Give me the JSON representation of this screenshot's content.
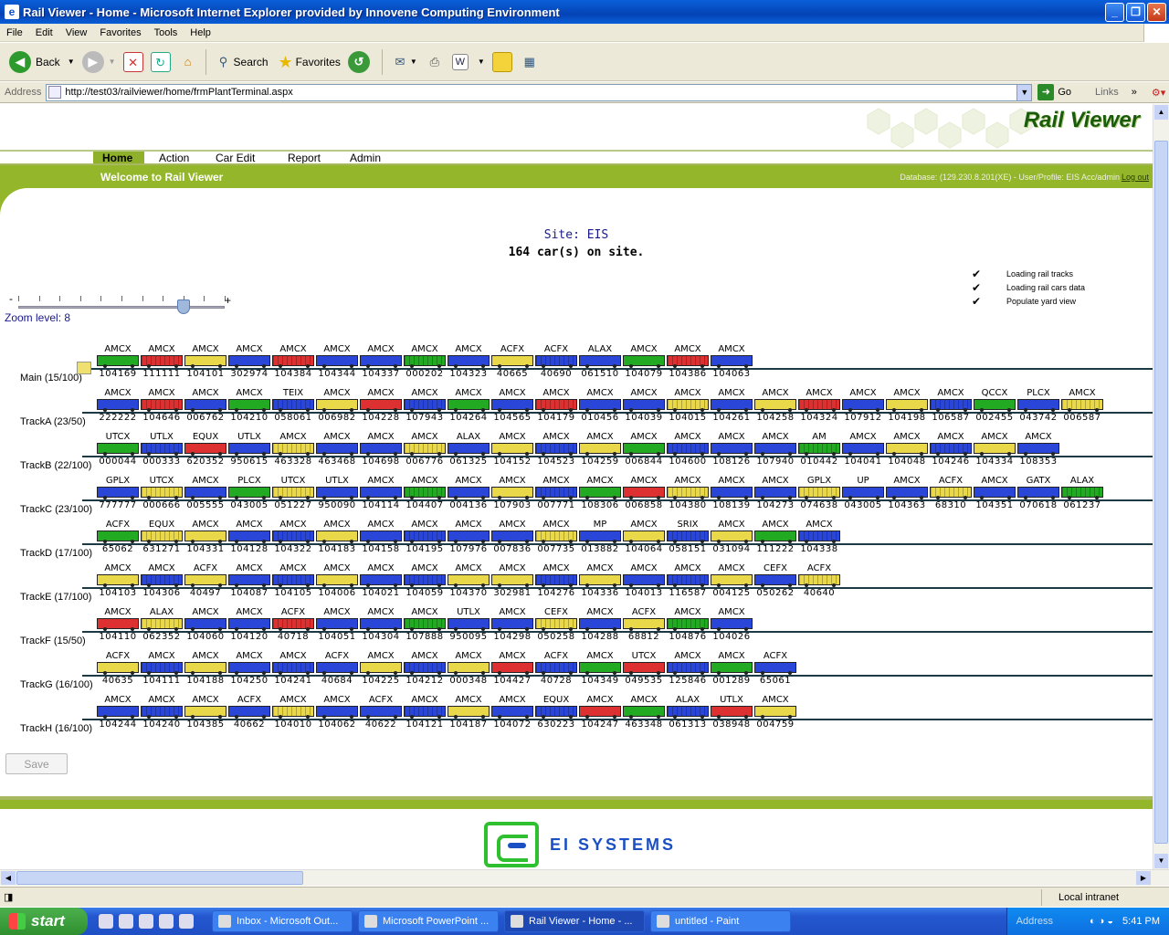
{
  "window": {
    "title": "Rail Viewer - Home - Microsoft Internet Explorer provided by Innovene Computing Environment"
  },
  "menu": [
    "File",
    "Edit",
    "View",
    "Favorites",
    "Tools",
    "Help"
  ],
  "toolbar": {
    "back": "Back",
    "search": "Search",
    "favorites": "Favorites"
  },
  "address": {
    "label": "Address",
    "url": "http://test03/railviewer/home/frmPlantTerminal.aspx",
    "go": "Go",
    "links": "Links"
  },
  "page": {
    "logo": "Rail Viewer",
    "nav": [
      "Home",
      "Action",
      "Car Edit",
      "Report",
      "Admin"
    ],
    "welcome_prefix": "Welcome to ",
    "welcome_app": "Rail Viewer",
    "db_info": "Database: (129.230.8.201(XE) - User/Profile: EIS Acc/admin",
    "logout": "Log out",
    "site": "Site: EIS",
    "count": "164 car(s) on site.",
    "checks": [
      "Loading rail tracks",
      "Loading rail cars data",
      "Populate yard view"
    ],
    "zoom_minus": "-",
    "zoom_plus": "+",
    "zoom_label": "Zoom level: 8",
    "zoom_level": 8,
    "zoom_max": 10,
    "save": "Save",
    "footer_brand": "EI SYSTEMS"
  },
  "colors": {
    "green": "#22aa22",
    "red": "#dd3030",
    "yellow": "#e8d84a",
    "blue": "#2a46d8"
  },
  "tracks": [
    {
      "label": "Main (15/100)",
      "cars": [
        [
          "AMCX",
          "104169",
          "g"
        ],
        [
          "AMCX",
          "111111",
          "r"
        ],
        [
          "AMCX",
          "104101",
          "y"
        ],
        [
          "AMCX",
          "302974",
          "b"
        ],
        [
          "AMCX",
          "104384",
          "r"
        ],
        [
          "AMCX",
          "104344",
          "b"
        ],
        [
          "AMCX",
          "104337",
          "b"
        ],
        [
          "AMCX",
          "000202",
          "g"
        ],
        [
          "AMCX",
          "104323",
          "b"
        ],
        [
          "ACFX",
          "40665",
          "y"
        ],
        [
          "ACFX",
          "40690",
          "b"
        ],
        [
          "ALAX",
          "061510",
          "b"
        ],
        [
          "AMCX",
          "104079",
          "g"
        ],
        [
          "AMCX",
          "104386",
          "r"
        ],
        [
          "AMCX",
          "104063",
          "b"
        ]
      ]
    },
    {
      "label": "TrackA (23/50)",
      "cars": [
        [
          "AMCX",
          "222222",
          "b"
        ],
        [
          "AMCX",
          "104646",
          "r"
        ],
        [
          "AMCX",
          "006762",
          "b"
        ],
        [
          "AMCX",
          "104210",
          "g"
        ],
        [
          "TEIX",
          "058061",
          "b"
        ],
        [
          "AMCX",
          "006982",
          "y"
        ],
        [
          "AMCX",
          "104228",
          "r"
        ],
        [
          "AMCX",
          "107943",
          "b"
        ],
        [
          "AMCX",
          "104264",
          "g"
        ],
        [
          "AMCX",
          "104565",
          "b"
        ],
        [
          "AMCX",
          "104179",
          "r"
        ],
        [
          "AMCX",
          "010456",
          "b"
        ],
        [
          "AMCX",
          "104039",
          "b"
        ],
        [
          "AMCX",
          "104015",
          "y"
        ],
        [
          "AMCX",
          "104261",
          "b"
        ],
        [
          "AMCX",
          "104258",
          "y"
        ],
        [
          "AMCX",
          "104324",
          "r"
        ],
        [
          "AMCX",
          "107912",
          "b"
        ],
        [
          "AMCX",
          "104198",
          "y"
        ],
        [
          "AMCX",
          "106587",
          "b"
        ],
        [
          "QCCX",
          "002455",
          "g"
        ],
        [
          "PLCX",
          "043742",
          "b"
        ],
        [
          "AMCX",
          "006587",
          "y"
        ]
      ]
    },
    {
      "label": "TrackB (22/100)",
      "cars": [
        [
          "UTCX",
          "000044",
          "g"
        ],
        [
          "UTLX",
          "000333",
          "b"
        ],
        [
          "EQUX",
          "620352",
          "r"
        ],
        [
          "UTLX",
          "950615",
          "b"
        ],
        [
          "AMCX",
          "463328",
          "y"
        ],
        [
          "AMCX",
          "463468",
          "b"
        ],
        [
          "AMCX",
          "104698",
          "b"
        ],
        [
          "AMCX",
          "006776",
          "y"
        ],
        [
          "ALAX",
          "061325",
          "b"
        ],
        [
          "AMCX",
          "104152",
          "y"
        ],
        [
          "AMCX",
          "104523",
          "b"
        ],
        [
          "AMCX",
          "104259",
          "y"
        ],
        [
          "AMCX",
          "006844",
          "g"
        ],
        [
          "AMCX",
          "104600",
          "b"
        ],
        [
          "AMCX",
          "108126",
          "b"
        ],
        [
          "AMCX",
          "107940",
          "b"
        ],
        [
          "AM",
          "010442",
          "g"
        ],
        [
          "AMCX",
          "104041",
          "b"
        ],
        [
          "AMCX",
          "104048",
          "y"
        ],
        [
          "AMCX",
          "104246",
          "b"
        ],
        [
          "AMCX",
          "104334",
          "y"
        ],
        [
          "AMCX",
          "108353",
          "b"
        ]
      ]
    },
    {
      "label": "TrackC (23/100)",
      "cars": [
        [
          "GPLX",
          "777777",
          "b"
        ],
        [
          "UTCX",
          "000666",
          "y"
        ],
        [
          "AMCX",
          "005555",
          "b"
        ],
        [
          "PLCX",
          "043005",
          "g"
        ],
        [
          "UTCX",
          "051227",
          "y"
        ],
        [
          "UTLX",
          "950090",
          "b"
        ],
        [
          "AMCX",
          "104114",
          "b"
        ],
        [
          "AMCX",
          "104407",
          "g"
        ],
        [
          "AMCX",
          "004136",
          "b"
        ],
        [
          "AMCX",
          "107903",
          "y"
        ],
        [
          "AMCX",
          "007771",
          "b"
        ],
        [
          "AMCX",
          "108306",
          "g"
        ],
        [
          "AMCX",
          "006858",
          "r"
        ],
        [
          "AMCX",
          "104380",
          "y"
        ],
        [
          "AMCX",
          "108139",
          "b"
        ],
        [
          "AMCX",
          "104273",
          "b"
        ],
        [
          "GPLX",
          "074638",
          "y"
        ],
        [
          "UP",
          "043005",
          "b"
        ],
        [
          "AMCX",
          "104363",
          "b"
        ],
        [
          "ACFX",
          "68310",
          "y"
        ],
        [
          "AMCX",
          "104351",
          "b"
        ],
        [
          "GATX",
          "070618",
          "b"
        ],
        [
          "ALAX",
          "061237",
          "g"
        ]
      ]
    },
    {
      "label": "TrackD (17/100)",
      "cars": [
        [
          "ACFX",
          "65062",
          "g"
        ],
        [
          "EQUX",
          "631271",
          "y"
        ],
        [
          "AMCX",
          "104331",
          "y"
        ],
        [
          "AMCX",
          "104128",
          "b"
        ],
        [
          "AMCX",
          "104322",
          "b"
        ],
        [
          "AMCX",
          "104183",
          "y"
        ],
        [
          "AMCX",
          "104158",
          "b"
        ],
        [
          "AMCX",
          "104195",
          "b"
        ],
        [
          "AMCX",
          "107976",
          "b"
        ],
        [
          "AMCX",
          "007836",
          "b"
        ],
        [
          "AMCX",
          "007735",
          "y"
        ],
        [
          "MP",
          "013882",
          "b"
        ],
        [
          "AMCX",
          "104064",
          "y"
        ],
        [
          "SRIX",
          "058151",
          "b"
        ],
        [
          "AMCX",
          "031094",
          "y"
        ],
        [
          "AMCX",
          "111222",
          "g"
        ],
        [
          "AMCX",
          "104338",
          "b"
        ]
      ]
    },
    {
      "label": "TrackE (17/100)",
      "cars": [
        [
          "AMCX",
          "104103",
          "y"
        ],
        [
          "AMCX",
          "104306",
          "b"
        ],
        [
          "ACFX",
          "40497",
          "y"
        ],
        [
          "AMCX",
          "104087",
          "b"
        ],
        [
          "AMCX",
          "104105",
          "b"
        ],
        [
          "AMCX",
          "104006",
          "y"
        ],
        [
          "AMCX",
          "104021",
          "b"
        ],
        [
          "AMCX",
          "104059",
          "b"
        ],
        [
          "AMCX",
          "104370",
          "y"
        ],
        [
          "AMCX",
          "302981",
          "y"
        ],
        [
          "AMCX",
          "104276",
          "b"
        ],
        [
          "AMCX",
          "104336",
          "y"
        ],
        [
          "AMCX",
          "104013",
          "b"
        ],
        [
          "AMCX",
          "116587",
          "b"
        ],
        [
          "AMCX",
          "004125",
          "y"
        ],
        [
          "CEFX",
          "050262",
          "b"
        ],
        [
          "ACFX",
          "40640",
          "y"
        ]
      ]
    },
    {
      "label": "TrackF (15/50)",
      "cars": [
        [
          "AMCX",
          "104110",
          "r"
        ],
        [
          "ALAX",
          "062352",
          "y"
        ],
        [
          "AMCX",
          "104060",
          "b"
        ],
        [
          "AMCX",
          "104120",
          "b"
        ],
        [
          "ACFX",
          "40718",
          "r"
        ],
        [
          "AMCX",
          "104051",
          "b"
        ],
        [
          "AMCX",
          "104304",
          "b"
        ],
        [
          "AMCX",
          "107888",
          "g"
        ],
        [
          "UTLX",
          "950095",
          "b"
        ],
        [
          "AMCX",
          "104298",
          "b"
        ],
        [
          "CEFX",
          "050258",
          "y"
        ],
        [
          "AMCX",
          "104288",
          "b"
        ],
        [
          "ACFX",
          "68812",
          "y"
        ],
        [
          "AMCX",
          "104876",
          "g"
        ],
        [
          "AMCX",
          "104026",
          "b"
        ]
      ]
    },
    {
      "label": "TrackG (16/100)",
      "cars": [
        [
          "ACFX",
          "40635",
          "y"
        ],
        [
          "AMCX",
          "104111",
          "b"
        ],
        [
          "AMCX",
          "104188",
          "y"
        ],
        [
          "AMCX",
          "104250",
          "b"
        ],
        [
          "AMCX",
          "104241",
          "b"
        ],
        [
          "ACFX",
          "40684",
          "b"
        ],
        [
          "AMCX",
          "104225",
          "y"
        ],
        [
          "AMCX",
          "104212",
          "b"
        ],
        [
          "AMCX",
          "000348",
          "y"
        ],
        [
          "AMCX",
          "104427",
          "r"
        ],
        [
          "ACFX",
          "40728",
          "b"
        ],
        [
          "AMCX",
          "104349",
          "g"
        ],
        [
          "UTCX",
          "049535",
          "r"
        ],
        [
          "AMCX",
          "125846",
          "b"
        ],
        [
          "AMCX",
          "001289",
          "g"
        ],
        [
          "ACFX",
          "65061",
          "b"
        ]
      ]
    },
    {
      "label": "TrackH (16/100)",
      "cars": [
        [
          "AMCX",
          "104244",
          "b"
        ],
        [
          "AMCX",
          "104240",
          "b"
        ],
        [
          "AMCX",
          "104385",
          "y"
        ],
        [
          "ACFX",
          "40662",
          "b"
        ],
        [
          "AMCX",
          "104010",
          "y"
        ],
        [
          "AMCX",
          "104062",
          "b"
        ],
        [
          "ACFX",
          "40622",
          "b"
        ],
        [
          "AMCX",
          "104121",
          "b"
        ],
        [
          "AMCX",
          "104187",
          "y"
        ],
        [
          "AMCX",
          "104072",
          "b"
        ],
        [
          "EQUX",
          "630223",
          "b"
        ],
        [
          "AMCX",
          "104247",
          "r"
        ],
        [
          "AMCX",
          "463348",
          "g"
        ],
        [
          "ALAX",
          "061313",
          "b"
        ],
        [
          "UTLX",
          "038948",
          "r"
        ],
        [
          "AMCX",
          "004759",
          "y"
        ]
      ]
    }
  ],
  "statusbar": {
    "zone": "Local intranet"
  },
  "taskbar": {
    "start": "start",
    "tasks": [
      "Inbox - Microsoft Out...",
      "Microsoft PowerPoint ...",
      "Rail Viewer - Home - ...",
      "untitled - Paint"
    ],
    "address": "Address",
    "clock": "5:41 PM"
  }
}
